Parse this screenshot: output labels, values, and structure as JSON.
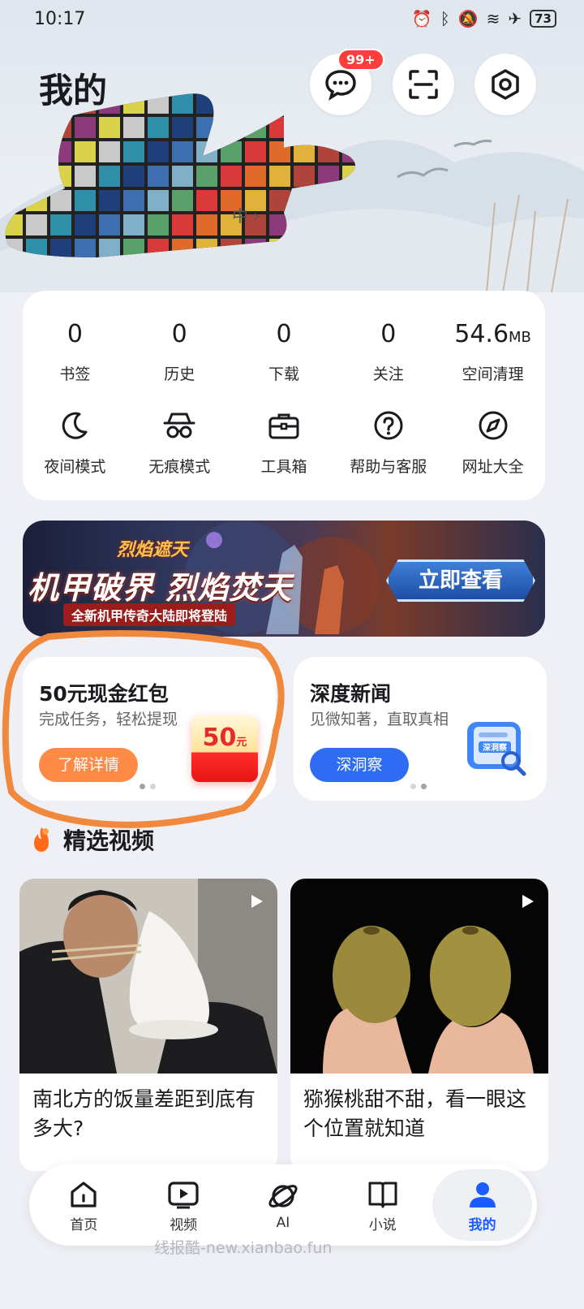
{
  "status_bar": {
    "time": "10:17",
    "icons": [
      "alarm-icon",
      "bluetooth-icon",
      "mute-icon",
      "wifi-icon",
      "airplane-icon"
    ],
    "battery": "73"
  },
  "header": {
    "title": "我的",
    "message_badge": "99+",
    "profile_sub": "中"
  },
  "stats": [
    {
      "value": "0",
      "unit": "",
      "label": "书签"
    },
    {
      "value": "0",
      "unit": "",
      "label": "历史"
    },
    {
      "value": "0",
      "unit": "",
      "label": "下载"
    },
    {
      "value": "0",
      "unit": "",
      "label": "关注"
    },
    {
      "value": "54.6",
      "unit": "MB",
      "label": "空间清理"
    }
  ],
  "tools": [
    {
      "label": "夜间模式",
      "icon": "moon-icon"
    },
    {
      "label": "无痕模式",
      "icon": "incognito-icon"
    },
    {
      "label": "工具箱",
      "icon": "toolbox-icon"
    },
    {
      "label": "帮助与客服",
      "icon": "help-icon"
    },
    {
      "label": "网址大全",
      "icon": "compass-icon"
    }
  ],
  "banner": {
    "logo": "烈焰遮天",
    "title": "机甲破界 烈焰焚天",
    "subtitle": "全新机甲传奇大陆即将登陆",
    "cta": "立即查看"
  },
  "promos": [
    {
      "title": "50元现金红包",
      "subtitle": "完成任务，轻松提现",
      "button": "了解详情",
      "image_value": "50",
      "image_unit": "元"
    },
    {
      "title": "深度新闻",
      "subtitle": "见微知著，直取真相",
      "button": "深洞察",
      "image_label": "深洞察"
    }
  ],
  "section": {
    "title": "精选视频"
  },
  "videos": [
    {
      "title": "南北方的饭量差距到底有多大?"
    },
    {
      "title": "猕猴桃甜不甜，看一眼这个位置就知道"
    }
  ],
  "tabs": [
    {
      "label": "首页",
      "icon": "home-icon"
    },
    {
      "label": "视频",
      "icon": "video-icon"
    },
    {
      "label": "AI",
      "icon": "planet-icon"
    },
    {
      "label": "小说",
      "icon": "book-icon"
    },
    {
      "label": "我的",
      "icon": "user-icon"
    }
  ],
  "watermark": "线报酷-new.xianbao.fun",
  "colors": {
    "accent_blue": "#1a5cff",
    "orange": "#ff8a45",
    "red": "#ff3d3d",
    "annotation": "#f0893e"
  }
}
